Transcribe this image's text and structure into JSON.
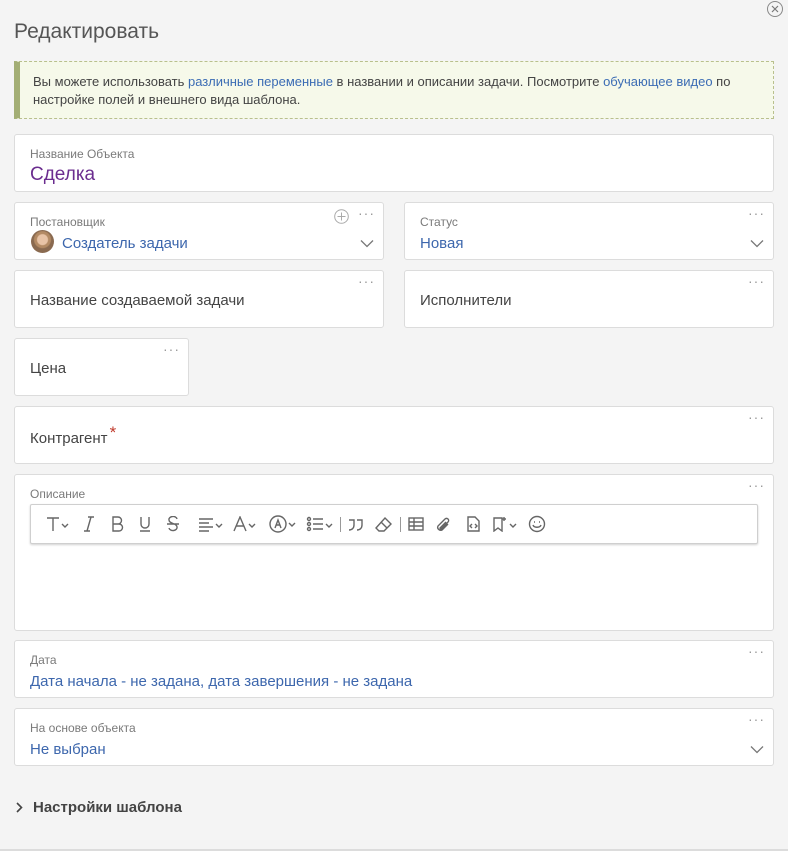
{
  "dialog": {
    "title": "Редактировать"
  },
  "notice": {
    "text1": "Вы можете использовать ",
    "link1": "различные переменные",
    "text2": " в названии и описании задачи. Посмотрите ",
    "link2": "обучающее видео",
    "text3": " по настройке полей и внешнего вида шаблона."
  },
  "object_name": {
    "label": "Название Объекта",
    "value": "Сделка",
    "value_color": "#6b2d8f"
  },
  "creator": {
    "label": "Постановщик",
    "value": "Создатель задачи"
  },
  "status": {
    "label": "Статус",
    "value": "Новая"
  },
  "task_name": {
    "label": "Название создаваемой задачи"
  },
  "assignees": {
    "label": "Исполнители"
  },
  "price": {
    "label": "Цена"
  },
  "counterparty": {
    "label": "Контрагент",
    "required_mark": "*"
  },
  "description": {
    "label": "Описание"
  },
  "date": {
    "label": "Дата",
    "value": "Дата начала - не задана, дата завершения - не задана"
  },
  "based_on": {
    "label": "На основе объекта",
    "value": "Не выбран"
  },
  "template_settings": {
    "label": "Настройки шаблона"
  },
  "more_label": "···",
  "colors": {
    "link": "#3d67ad",
    "accent_green": "#a3ae75",
    "required": "#c0392b"
  }
}
